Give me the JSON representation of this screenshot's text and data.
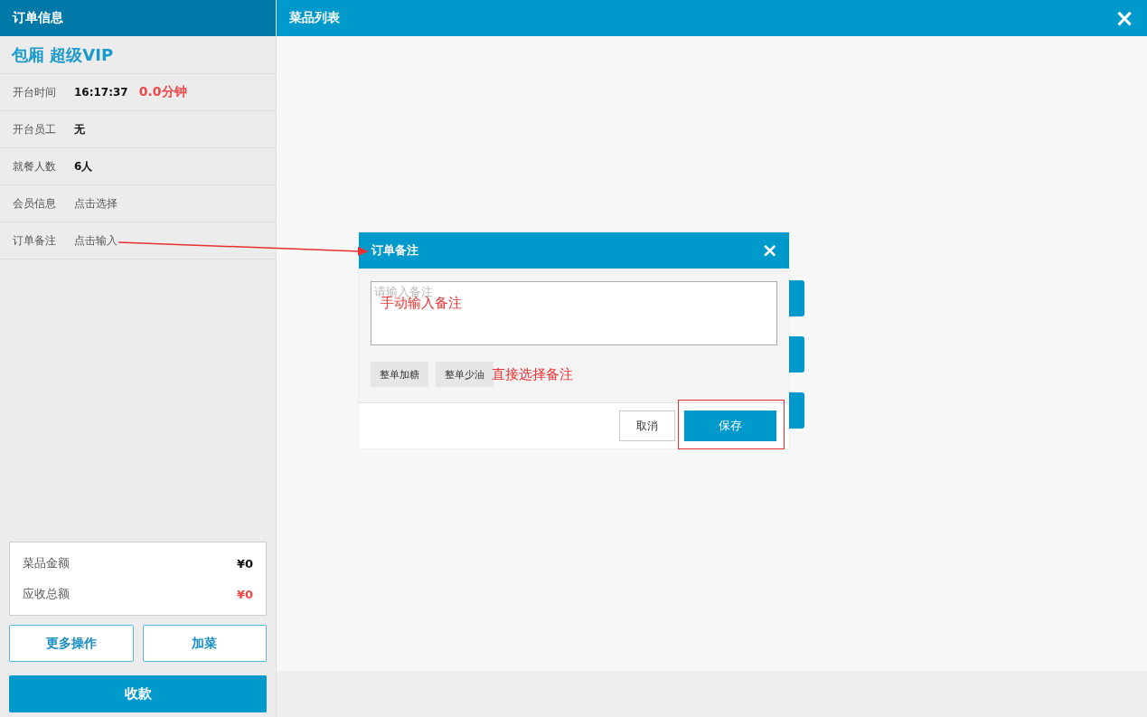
{
  "sidebar": {
    "title": "订单信息",
    "table_name": "包厢 超级VIP",
    "fields": [
      {
        "label": "开台时间",
        "value": "16:17:37",
        "kind": "value",
        "note": "0.0分钟"
      },
      {
        "label": "开台员工",
        "value": "无",
        "kind": "value"
      },
      {
        "label": "就餐人数",
        "value": "6人",
        "kind": "value"
      },
      {
        "label": "会员信息",
        "value": "点击选择",
        "kind": "action"
      },
      {
        "label": "订单备注",
        "value": "点击输入",
        "kind": "action"
      }
    ],
    "totals": [
      {
        "label": "菜品金额",
        "value": "¥0",
        "highlight": false
      },
      {
        "label": "应收总额",
        "value": "¥0",
        "highlight": true
      }
    ],
    "actions": [
      "更多操作",
      "加菜"
    ],
    "primary_action": "收款"
  },
  "main": {
    "title": "菜品列表",
    "close": "×"
  },
  "dialog": {
    "title": "订单备注",
    "close": "×",
    "note_placeholder": "请输入备注",
    "presets": [
      "整单加糖",
      "整单少油"
    ],
    "cancel": "取消",
    "save": "保存"
  },
  "annotations": [
    {
      "kind": "field_note",
      "text": "手动输入备注"
    },
    {
      "kind": "preset_note",
      "text": "直接选择备注"
    },
    {
      "kind": "arrow"
    },
    {
      "kind": "frame"
    }
  ]
}
